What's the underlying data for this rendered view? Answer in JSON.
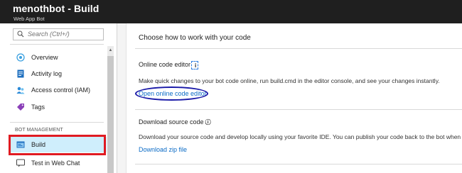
{
  "app": {
    "title": "menothbot - Build",
    "subtitle": "Web App Bot"
  },
  "search": {
    "placeholder": "Search (Ctrl+/)"
  },
  "sidebar": {
    "items": [
      {
        "label": "Overview",
        "icon": "overview-icon"
      },
      {
        "label": "Activity log",
        "icon": "activity-log-icon"
      },
      {
        "label": "Access control (IAM)",
        "icon": "access-control-icon"
      },
      {
        "label": "Tags",
        "icon": "tag-icon"
      }
    ],
    "section_label": "BOT MANAGEMENT",
    "bot_items": [
      {
        "label": "Build",
        "icon": "build-icon",
        "selected": true
      },
      {
        "label": "Test in Web Chat",
        "icon": "chat-icon"
      }
    ]
  },
  "main": {
    "heading": "Choose how to work with your code",
    "online_editor": {
      "title": "Online code editor",
      "description": "Make quick changes to your bot code online, run build.cmd in the editor console, and see your changes instantly.",
      "link": "Open online code editor"
    },
    "download": {
      "title": "Download source code",
      "description": "Download your source code and develop locally using your favorite IDE. You can publish your code back to the bot when ready.",
      "link": "Download zip file"
    }
  },
  "colors": {
    "titlebar": "#1f1f1f",
    "selected": "#cfeefc",
    "link": "#0b6bc6",
    "annotation_red": "#e01b22",
    "annotation_ellipse": "#1a1aa8"
  }
}
